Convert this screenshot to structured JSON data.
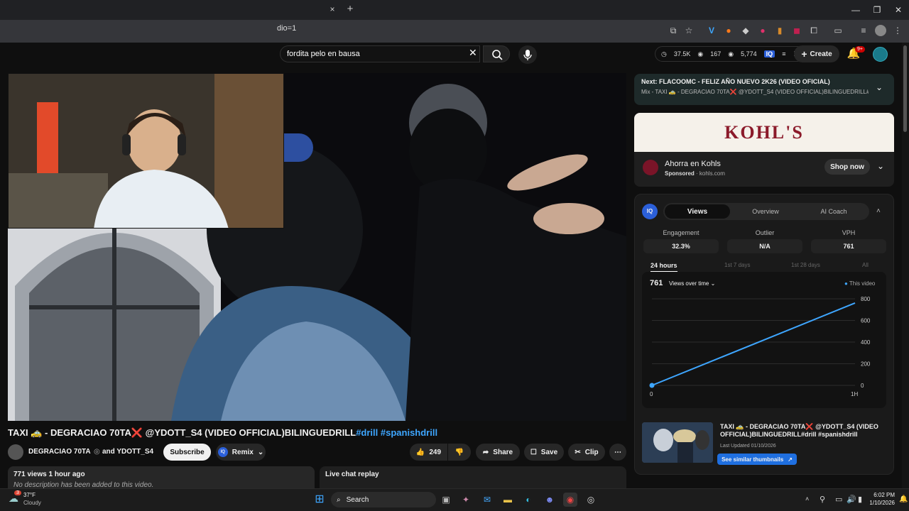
{
  "browser": {
    "url_fragment": "dio=1",
    "tab_close": "×",
    "new_tab": "+"
  },
  "header": {
    "search_value": "fordita pelo en bausa",
    "stats": {
      "watched": "37.5K",
      "likes": "167",
      "views": "5,774"
    },
    "create_label": "Create",
    "notif_badge": "9+"
  },
  "video": {
    "title": "TAXI 🚕 - DEGRACIAO 70TA❌ @YDOTT_S4 (VIDEO OFFICIAL)BILINGUEDRILL",
    "tags": "#drill #spanishdrill",
    "channel": "DEGRACIAO 70TA",
    "and_collab": "and YDOTT_S4",
    "subscribe_label": "Subscribe",
    "remix_label": "Remix",
    "likes": "249",
    "share_label": "Share",
    "save_label": "Save",
    "clip_label": "Clip",
    "views_time": "771 views  1 hour ago",
    "description": "No description has been added to this video.",
    "chat_replay": "Live chat replay"
  },
  "sidebar": {
    "next_prefix": "Next:",
    "next_title": "FLACOOMC - FELIZ AÑO NUEVO 2K26 (VIDEO OFICIAL)",
    "next_mix": "Mix - TAXI 🚕 - DEGRACIAO 70TA❌ @YDOTT_S4 (VIDEO OFFICIAL)BILINGUEDRILL#dril...",
    "ad": {
      "brand_logo": "KOHL'S",
      "title": "Ahorra en Kohls",
      "sponsored": "Sponsored",
      "domain": "kohls.com",
      "cta": "Shop now"
    },
    "iq": {
      "tabs": [
        "Views",
        "Overview",
        "AI Coach"
      ],
      "metrics": [
        {
          "label": "Engagement",
          "value": "32.3%"
        },
        {
          "label": "Outlier",
          "value": "N/A"
        },
        {
          "label": "VPH",
          "value": "761"
        }
      ],
      "ranges": [
        "24 hours",
        "1st 7 days",
        "1st 28 days",
        "All"
      ],
      "chart_value": "761",
      "chart_selector": "Views over time",
      "legend": "This video",
      "similar": {
        "title": "TAXI 🚕 - DEGRACIAO 70TA❌ @YDOTT_S4 (VIDEO OFFICIAL)BILINGUEDRILL#drill #spanishdrill",
        "updated": "Last Updated 01/10/2026",
        "button": "See similar thumbnails"
      }
    }
  },
  "chart_data": {
    "type": "line",
    "x": [
      0,
      1
    ],
    "x_tick_labels": [
      "0",
      "1H"
    ],
    "series": [
      {
        "name": "This video",
        "values": [
          0,
          761
        ]
      }
    ],
    "y_ticks": [
      0,
      200,
      400,
      600,
      800
    ],
    "ylim": [
      0,
      800
    ],
    "grid": true,
    "legend_position": "top-right",
    "color": "#3ea6ff"
  },
  "taskbar": {
    "weather_temp": "37°F",
    "weather_desc": "Cloudy",
    "weather_badge": "3",
    "search_label": "Search",
    "time": "6:02 PM",
    "date": "1/10/2026"
  }
}
